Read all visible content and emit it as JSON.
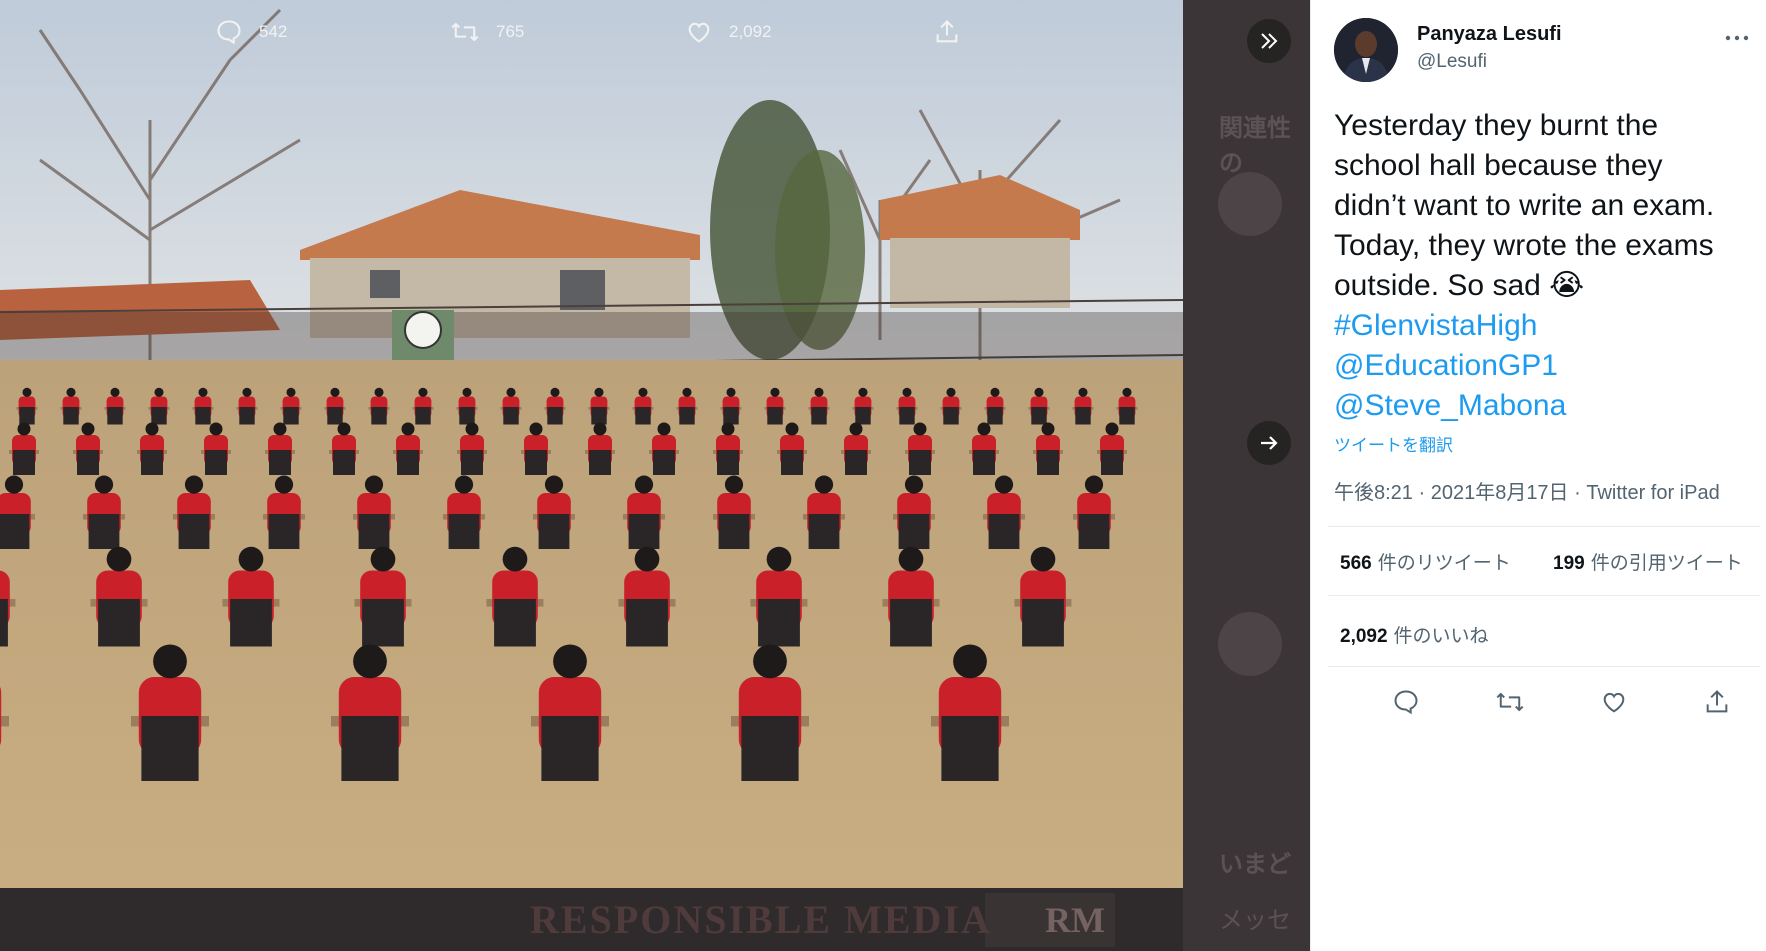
{
  "tweet": {
    "display_name": "Panyaza Lesufi",
    "username": "@Lesufi",
    "more_icon": "more-horizontal-icon",
    "text_lines": [
      "Yesterday they burnt the",
      "school hall because they",
      "didn’t want to write an exam.",
      "Today, they wrote the exams",
      "outside. So sad 😭"
    ],
    "hashtag": "#GlenvistaHigh",
    "mentions": [
      "@EducationGP1",
      "@Steve_Mabona"
    ],
    "translate_label": "ツイートを翻訳",
    "timestamp": "午後8:21 · 2021年8月17日 · Twitter for iPad",
    "stats": {
      "retweets_count": "566",
      "retweets_label": "件のリツイート",
      "quotes_count": "199",
      "quotes_label": "件の引用ツイート",
      "likes_count": "2,092",
      "likes_label": "件のいいね"
    },
    "actions": [
      "reply-icon",
      "retweet-icon",
      "like-icon",
      "share-icon"
    ]
  },
  "media": {
    "replies": "542",
    "retweets": "765",
    "likes": "2,092",
    "watermark": "RESPONSIBLE MEDIA",
    "watermark_badge": "RM",
    "background_sidebar": {
      "heading_fragment": "関連性の",
      "now_fragment": "いまど",
      "message_fragment": "メッセ"
    }
  },
  "colors": {
    "accent": "#1d9bf0",
    "text_primary": "#0f1419",
    "text_secondary": "#536471",
    "media_bg": "#3a3234",
    "uniform_red": "#c9202a"
  }
}
